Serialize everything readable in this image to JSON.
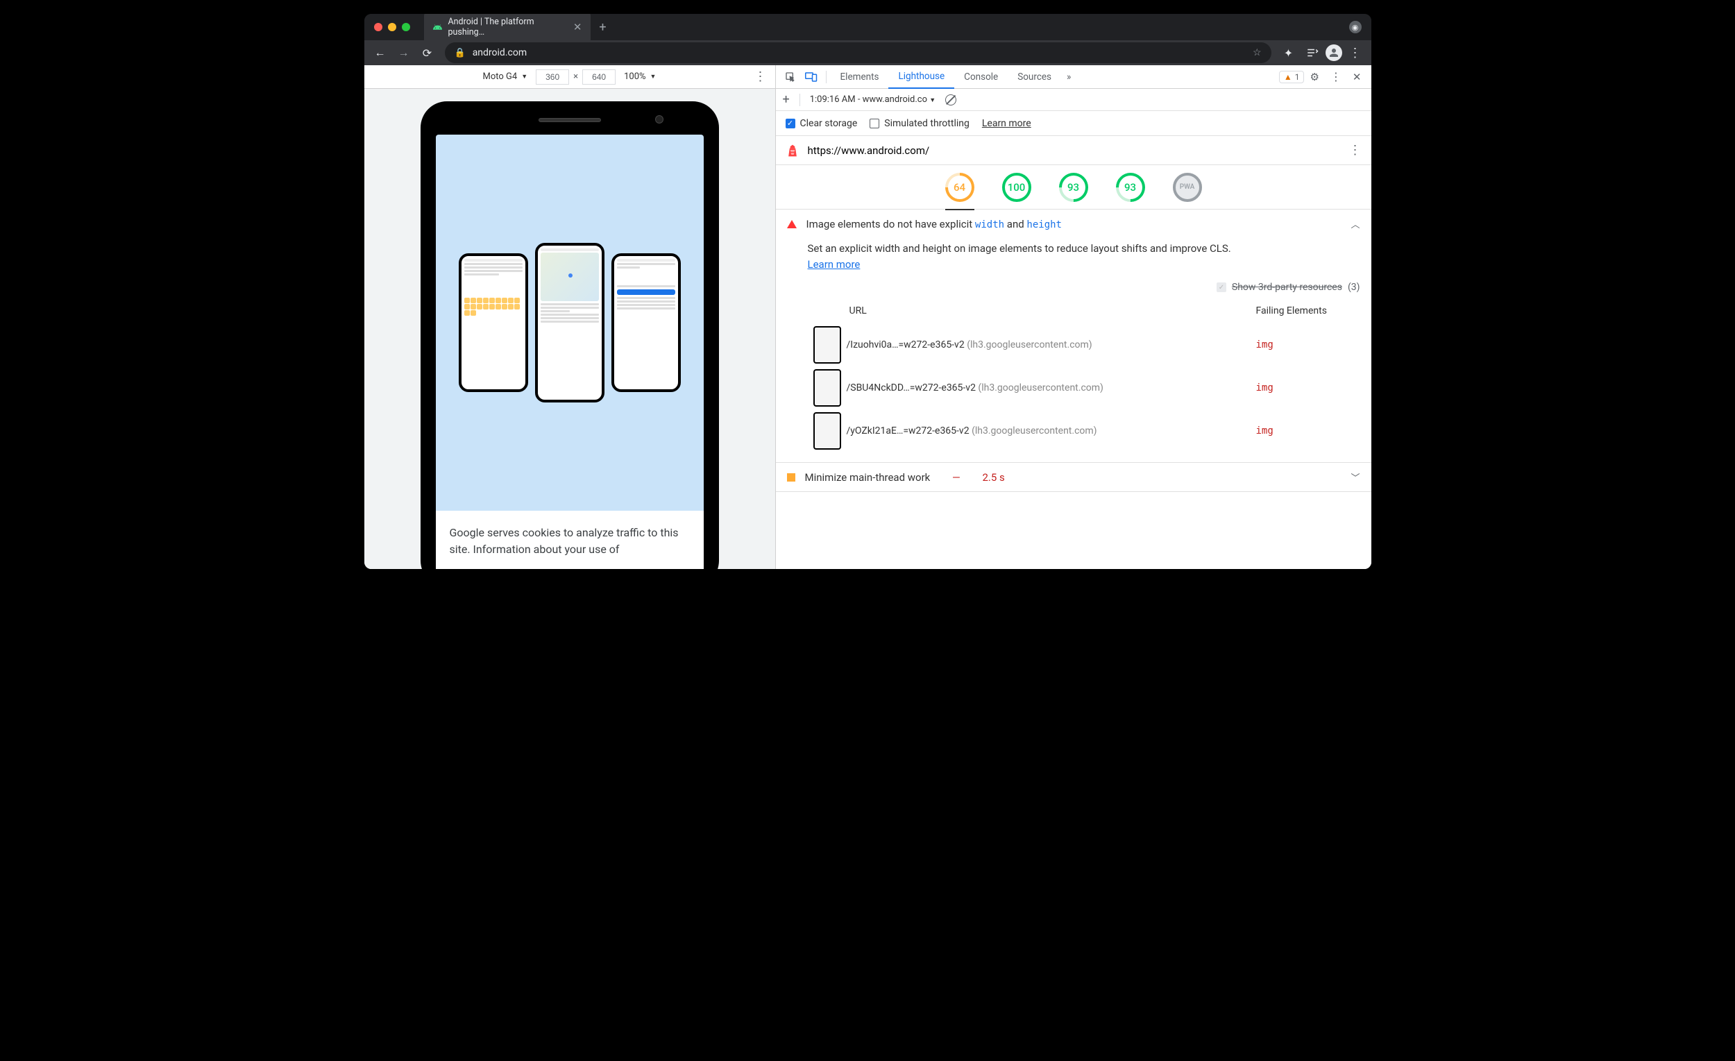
{
  "browser": {
    "tab_title": "Android | The platform pushing…",
    "url_display": "android.com"
  },
  "device_toolbar": {
    "device": "Moto G4",
    "width": "360",
    "height": "640",
    "dim_sep": "×",
    "zoom": "100%"
  },
  "preview_cookie": "Google serves cookies to analyze traffic to this site. Information about your use of",
  "devtools": {
    "tabs": {
      "elements": "Elements",
      "lighthouse": "Lighthouse",
      "console": "Console",
      "sources": "Sources"
    },
    "warn_count": "1",
    "lh_toolbar": {
      "report_label": "1:09:16 AM - www.android.co"
    },
    "options": {
      "clear": "Clear storage",
      "throttle": "Simulated throttling",
      "learn": "Learn more"
    },
    "url": "https://www.android.com/",
    "scores": {
      "s1": "64",
      "s2": "100",
      "s3": "93",
      "s4": "93",
      "pwa": "PWA"
    },
    "audit1": {
      "title_a": "Image elements do not have explicit ",
      "code1": "width",
      "mid": " and ",
      "code2": "height",
      "desc": "Set an explicit width and height on image elements to reduce layout shifts and improve CLS.",
      "learn": "Learn more",
      "thirdparty_label": "Show 3rd-party resources",
      "thirdparty_count": "(3)",
      "col_url": "URL",
      "col_fail": "Failing Elements",
      "rows": [
        {
          "path": "/Izuohvi0a…=w272-e365-v2",
          "domain": "(lh3.googleusercontent.com)",
          "el": "img"
        },
        {
          "path": "/SBU4NckDD…=w272-e365-v2",
          "domain": "(lh3.googleusercontent.com)",
          "el": "img"
        },
        {
          "path": "/yOZkI21aE…=w272-e365-v2",
          "domain": "(lh3.googleusercontent.com)",
          "el": "img"
        }
      ]
    },
    "audit2": {
      "title": "Minimize main-thread work",
      "sep": "—",
      "value": "2.5 s"
    }
  }
}
